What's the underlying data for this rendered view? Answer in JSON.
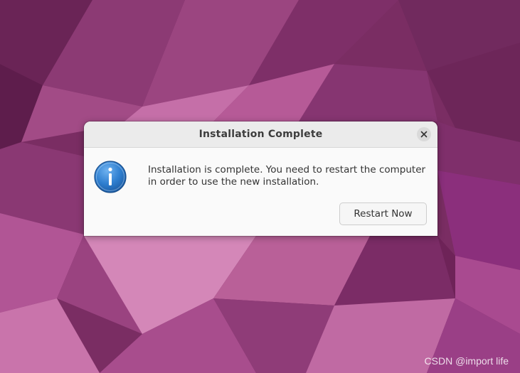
{
  "dialog": {
    "title": "Installation Complete",
    "message_line1": "Installation is complete. You need to restart the computer",
    "message_line2": "in order to use the new installation.",
    "restart_label": "Restart Now",
    "close_icon": "close-icon",
    "info_icon": "info-icon"
  },
  "watermark": "CSDN @import life",
  "colors": {
    "wallpaper_base": "#7a2d63",
    "dialog_bg": "#fafafa",
    "titlebar_bg": "#ebebeb",
    "info_icon_blue": "#2f7fd0"
  }
}
